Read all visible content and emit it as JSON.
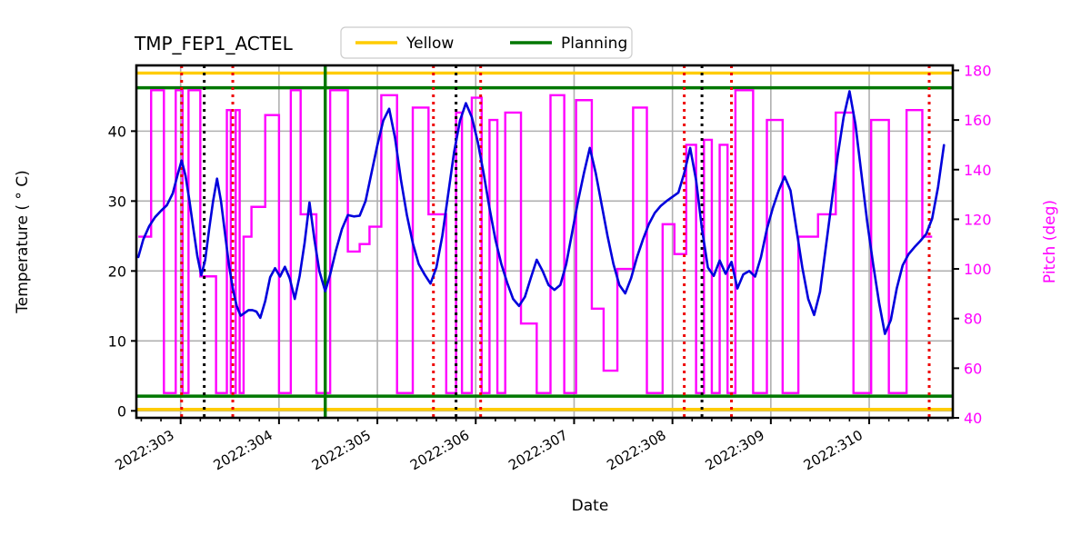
{
  "chart_data": {
    "type": "line",
    "title": "TMP_FEP1_ACTEL",
    "xlabel": "Date",
    "ylabel": "Temperature ( ° C)",
    "y2label": "Pitch (deg)",
    "grid": true,
    "legend_position": "top-center",
    "xlim": [
      302.55,
      310.85
    ],
    "ylim": [
      -1.0,
      49.4
    ],
    "y2lim": [
      40,
      182
    ],
    "xtick_labels": [
      "2022:303",
      "2022:304",
      "2022:305",
      "2022:306",
      "2022:307",
      "2022:308",
      "2022:309",
      "2022:310"
    ],
    "xtick_values": [
      303,
      304,
      305,
      306,
      307,
      308,
      309,
      310
    ],
    "ytick_labels": [
      "0",
      "10",
      "20",
      "30",
      "40"
    ],
    "ytick_values": [
      0,
      10,
      20,
      30,
      40
    ],
    "y2tick_labels": [
      "40",
      "60",
      "80",
      "100",
      "120",
      "140",
      "160",
      "180"
    ],
    "y2tick_values": [
      40,
      60,
      80,
      100,
      120,
      140,
      160,
      180
    ],
    "legend": [
      {
        "name": "Yellow",
        "color": "#ffcc00"
      },
      {
        "name": "Planning",
        "color": "#007700"
      }
    ],
    "limit_lines": [
      {
        "name": "yellow_high",
        "value": 48.3,
        "color": "#ffcc00",
        "axis": "left"
      },
      {
        "name": "planning_high",
        "value": 46.2,
        "color": "#007700",
        "axis": "left"
      },
      {
        "name": "planning_low",
        "value": 2.1,
        "color": "#007700",
        "axis": "left"
      },
      {
        "name": "yellow_low",
        "value": 0.2,
        "color": "#ffcc00",
        "axis": "left"
      }
    ],
    "vertical_lines": [
      {
        "x": 303.01,
        "color": "#ee0000",
        "style": "dotted"
      },
      {
        "x": 303.24,
        "color": "#000000",
        "style": "dotted"
      },
      {
        "x": 303.53,
        "color": "#ee0000",
        "style": "dotted"
      },
      {
        "x": 304.47,
        "color": "#007700",
        "style": "solid"
      },
      {
        "x": 305.57,
        "color": "#ee0000",
        "style": "dotted"
      },
      {
        "x": 305.8,
        "color": "#000000",
        "style": "dotted"
      },
      {
        "x": 306.05,
        "color": "#ee0000",
        "style": "dotted"
      },
      {
        "x": 308.12,
        "color": "#ee0000",
        "style": "dotted"
      },
      {
        "x": 308.3,
        "color": "#000000",
        "style": "dotted"
      },
      {
        "x": 308.6,
        "color": "#ee0000",
        "style": "dotted"
      },
      {
        "x": 310.61,
        "color": "#ee0000",
        "style": "dotted"
      }
    ],
    "series": [
      {
        "name": "Temperature",
        "color": "#0000dd",
        "axis": "left",
        "x": [
          302.57,
          302.62,
          302.68,
          302.74,
          302.8,
          302.86,
          302.92,
          302.97,
          303.01,
          303.05,
          303.09,
          303.13,
          303.17,
          303.21,
          303.25,
          303.29,
          303.33,
          303.37,
          303.41,
          303.45,
          303.49,
          303.53,
          303.57,
          303.61,
          303.65,
          303.69,
          303.73,
          303.77,
          303.81,
          303.86,
          303.91,
          303.96,
          304.01,
          304.06,
          304.11,
          304.16,
          304.21,
          304.26,
          304.31,
          304.36,
          304.41,
          304.47,
          304.52,
          304.58,
          304.64,
          304.7,
          304.76,
          304.82,
          304.88,
          304.94,
          305.0,
          305.06,
          305.12,
          305.18,
          305.24,
          305.3,
          305.36,
          305.42,
          305.48,
          305.54,
          305.6,
          305.66,
          305.72,
          305.78,
          305.84,
          305.9,
          305.96,
          306.02,
          306.08,
          306.14,
          306.2,
          306.26,
          306.32,
          306.38,
          306.44,
          306.5,
          306.56,
          306.62,
          306.68,
          306.74,
          306.8,
          306.86,
          306.92,
          306.98,
          307.04,
          307.1,
          307.16,
          307.22,
          307.28,
          307.34,
          307.4,
          307.46,
          307.52,
          307.58,
          307.64,
          307.7,
          307.76,
          307.82,
          307.88,
          307.94,
          308.0,
          308.06,
          308.12,
          308.18,
          308.24,
          308.3,
          308.36,
          308.42,
          308.48,
          308.54,
          308.6,
          308.66,
          308.72,
          308.78,
          308.84,
          308.9,
          308.96,
          309.02,
          309.08,
          309.14,
          309.2,
          309.26,
          309.32,
          309.38,
          309.44,
          309.5,
          309.56,
          309.62,
          309.68,
          309.74,
          309.8,
          309.86,
          309.92,
          309.98,
          310.04,
          310.1,
          310.16,
          310.22,
          310.28,
          310.34,
          310.4,
          310.46,
          310.52,
          310.58,
          310.64,
          310.7,
          310.76
        ],
        "y": [
          22.0,
          24.5,
          26.4,
          27.7,
          28.6,
          29.4,
          31.1,
          33.8,
          35.8,
          33.6,
          30.0,
          26.0,
          22.1,
          19.4,
          21.6,
          26.0,
          30.0,
          33.2,
          30.0,
          25.5,
          21.0,
          17.5,
          15.0,
          13.6,
          14.0,
          14.4,
          14.4,
          14.2,
          13.3,
          15.7,
          19.1,
          20.4,
          19.2,
          20.6,
          18.9,
          16.0,
          19.3,
          24.0,
          29.8,
          24.5,
          20.0,
          17.1,
          19.5,
          23.0,
          26.0,
          28.0,
          27.8,
          27.9,
          30.0,
          34.0,
          38.0,
          41.5,
          43.2,
          39.0,
          33.0,
          28.0,
          24.0,
          21.0,
          19.5,
          18.2,
          20.5,
          25.0,
          31.0,
          37.0,
          41.5,
          44.0,
          42.0,
          38.5,
          34.0,
          29.0,
          24.5,
          21.0,
          18.3,
          16.0,
          15.0,
          16.3,
          19.0,
          21.6,
          20.0,
          18.0,
          17.3,
          18.0,
          21.0,
          25.5,
          30.0,
          34.0,
          37.6,
          34.0,
          29.5,
          25.0,
          21.0,
          18.0,
          16.8,
          19.0,
          22.0,
          24.5,
          26.7,
          28.3,
          29.3,
          30.0,
          30.6,
          31.2,
          34.0,
          37.6,
          33.0,
          26.0,
          20.5,
          19.3,
          21.5,
          19.6,
          21.3,
          17.5,
          19.5,
          20.0,
          19.2,
          22.0,
          26.0,
          29.0,
          31.5,
          33.5,
          31.5,
          26.0,
          20.5,
          16.0,
          13.7,
          17.0,
          23.5,
          30.0,
          36.5,
          42.0,
          45.7,
          41.0,
          34.0,
          27.0,
          21.0,
          15.5,
          11.0,
          13.0,
          17.5,
          20.8,
          22.4,
          23.4,
          24.3,
          25.3,
          27.5,
          32.0,
          38.0
        ]
      },
      {
        "name": "Pitch",
        "color": "#ff00ff",
        "axis": "right",
        "step": true,
        "x": [
          302.57,
          302.7,
          302.7,
          302.83,
          302.83,
          302.95,
          302.95,
          303.02,
          303.02,
          303.08,
          303.08,
          303.2,
          303.2,
          303.36,
          303.36,
          303.47,
          303.47,
          303.51,
          303.51,
          303.56,
          303.56,
          303.6,
          303.6,
          303.64,
          303.64,
          303.72,
          303.72,
          303.86,
          303.86,
          304.0,
          304.0,
          304.12,
          304.12,
          304.22,
          304.22,
          304.38,
          304.38,
          304.52,
          304.52,
          304.7,
          304.7,
          304.82,
          304.82,
          304.92,
          304.92,
          305.04,
          305.04,
          305.2,
          305.2,
          305.36,
          305.36,
          305.52,
          305.52,
          305.7,
          305.7,
          305.8,
          305.8,
          305.86,
          305.86,
          305.96,
          305.96,
          306.06,
          306.06,
          306.14,
          306.14,
          306.22,
          306.22,
          306.3,
          306.3,
          306.46,
          306.46,
          306.62,
          306.62,
          306.76,
          306.76,
          306.9,
          306.9,
          307.02,
          307.02,
          307.18,
          307.18,
          307.3,
          307.3,
          307.44,
          307.44,
          307.6,
          307.6,
          307.74,
          307.74,
          307.9,
          307.9,
          308.02,
          308.02,
          308.14,
          308.14,
          308.24,
          308.24,
          308.32,
          308.32,
          308.4,
          308.4,
          308.48,
          308.48,
          308.56,
          308.56,
          308.64,
          308.64,
          308.82,
          308.82,
          308.96,
          308.96,
          309.12,
          309.12,
          309.28,
          309.28,
          309.48,
          309.48,
          309.66,
          309.66,
          309.84,
          309.84,
          310.02,
          310.02,
          310.2,
          310.2,
          310.38,
          310.38,
          310.54,
          310.54,
          310.64,
          310.64,
          310.76
        ],
        "y": [
          113,
          113,
          172,
          172,
          50,
          50,
          172,
          172,
          50,
          50,
          172,
          172,
          97,
          97,
          50,
          50,
          164,
          164,
          50,
          50,
          164,
          164,
          50,
          50,
          113,
          113,
          125,
          125,
          162,
          162,
          50,
          50,
          172,
          172,
          122,
          122,
          50,
          50,
          172,
          172,
          107,
          107,
          110,
          110,
          117,
          117,
          170,
          170,
          50,
          50,
          165,
          165,
          122,
          122,
          50,
          50,
          163,
          163,
          50,
          50,
          169,
          169,
          50,
          50,
          160,
          160,
          50,
          50,
          163,
          163,
          78,
          78,
          50,
          50,
          170,
          170,
          50,
          50,
          168,
          168,
          84,
          84,
          59,
          59,
          100,
          100,
          165,
          165,
          50,
          50,
          118,
          118,
          106,
          106,
          150,
          150,
          50,
          50,
          152,
          152,
          50,
          50,
          150,
          150,
          50,
          50,
          172,
          172,
          50,
          50,
          160,
          160,
          50,
          50,
          113,
          113,
          122,
          122,
          163,
          163,
          50,
          50,
          160,
          160,
          50,
          50,
          164,
          164,
          113,
          113
        ]
      }
    ]
  }
}
